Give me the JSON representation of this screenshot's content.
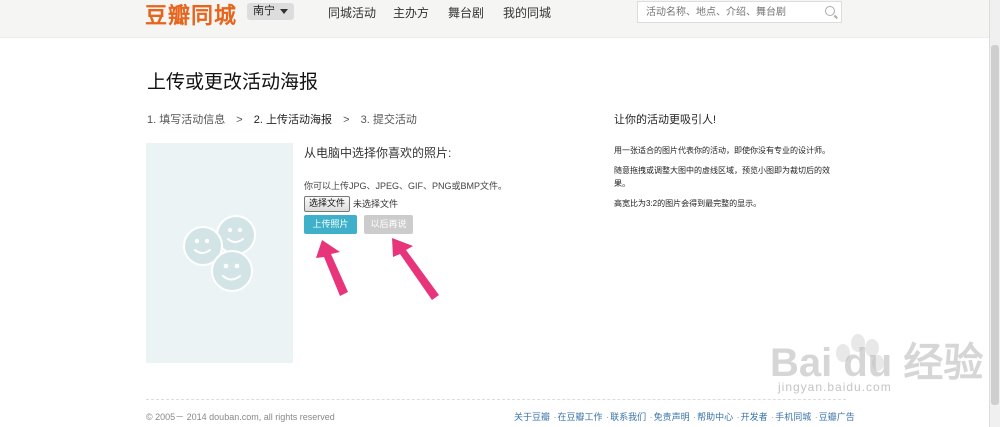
{
  "header": {
    "logo": "豆瓣同城",
    "city": "南宁",
    "nav": [
      "同城活动",
      "主办方",
      "舞台剧",
      "我的同城"
    ],
    "search_placeholder": "活动名称、地点、介绍、舞台剧"
  },
  "page": {
    "title": "上传或更改活动海报",
    "steps": [
      "1. 填写活动信息",
      ">",
      "2. 上传活动海报",
      ">",
      "3. 提交活动"
    ]
  },
  "upload": {
    "title": "从电脑中选择你喜欢的照片:",
    "formats": "你可以上传JPG、JPEG、GIF、PNG或BMP文件。",
    "file_button": "选择文件",
    "file_status": "未选择文件",
    "upload_button": "上传照片",
    "later_button": "以后再说"
  },
  "sidebar": {
    "title": "让你的活动更吸引人!",
    "tips": [
      "用一张适合的图片代表你的活动，即使你没有专业的设计师。",
      "随意拖拽或调整大图中的虚线区域，预览小图即为裁切后的效果。",
      "高宽比为3:2的图片会得到最完整的显示。"
    ]
  },
  "footer": {
    "copyright": "© 2005－ 2014 douban.com, all rights reserved",
    "links": [
      "关于豆瓣",
      "在豆瓣工作",
      "联系我们",
      "免责声明",
      "帮助中心",
      "开发者",
      "手机同城",
      "豆瓣广告"
    ]
  },
  "watermark": {
    "text": "Bai du 经验",
    "url": "jingyan.baidu.com"
  },
  "colors": {
    "logo": "#e7641c",
    "upload_button": "#3eb0c9",
    "arrow": "#e8347a"
  }
}
